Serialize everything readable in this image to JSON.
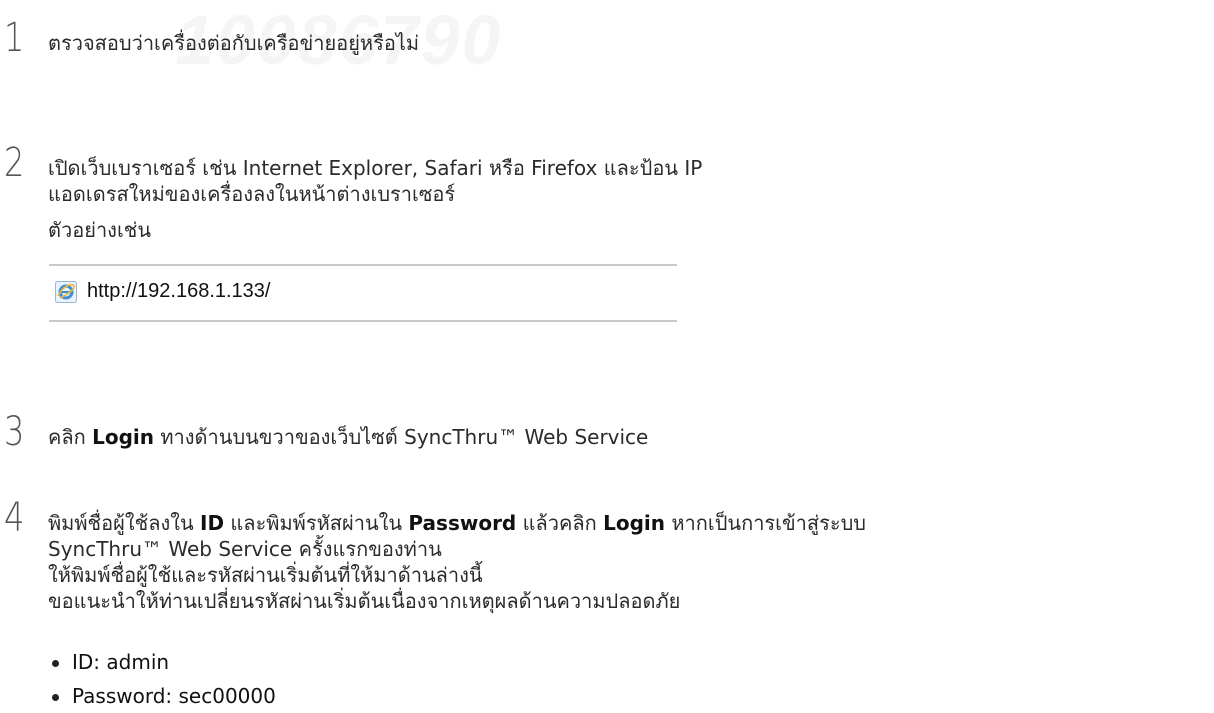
{
  "watermark": "10086790",
  "steps": [
    {
      "number": "1",
      "lines": [
        "ตรวจสอบว่าเครื่องต่อกับเครือข่ายอยู่หรือไม่"
      ]
    },
    {
      "number": "2",
      "lines": [
        "เปิดเว็บเบราเซอร์ เช่น Internet Explorer, Safari หรือ Firefox และป้อน IP",
        "แอดเดรสใหม่ของเครื่องลงในหน้าต่างเบราเซอร์"
      ],
      "example_label": "ตัวอย่างเช่น",
      "url": "http://192.168.1.133/"
    },
    {
      "number": "3",
      "parts": [
        "คลิก ",
        "Login",
        " ทางด้านบนขวาของเว็บไซต์ SyncThru™ Web Service"
      ]
    },
    {
      "number": "4",
      "line1_parts": [
        "พิมพ์ชื่อผู้ใช้ลงใน ",
        "ID",
        " และพิมพ์รหัสผ่านใน ",
        "Password",
        " แล้วคลิก ",
        "Login",
        " หากเป็นการเข้าสู่ระบบ"
      ],
      "lines": [
        "SyncThru™ Web Service ครั้งแรกของท่าน",
        "ให้พิมพ์ชื่อผู้ใช้และรหัสผ่านเริ่มต้นที่ให้มาด้านล่างนี้",
        "ขอแนะนำให้ท่านเปลี่ยนรหัสผ่านเริ่มต้นเนื่องจากเหตุผลด้านความปลอดภัย"
      ],
      "bullets": [
        "ID: admin",
        "Password: sec00000"
      ]
    }
  ],
  "icons": {
    "browser": "internet-explorer-icon",
    "bullet": "bullet-dot-icon"
  },
  "colors": {
    "text": "#2b2b2b",
    "step_number": "#555555",
    "watermark": "#f5f5f5",
    "url_border": "#c8c8c8"
  }
}
